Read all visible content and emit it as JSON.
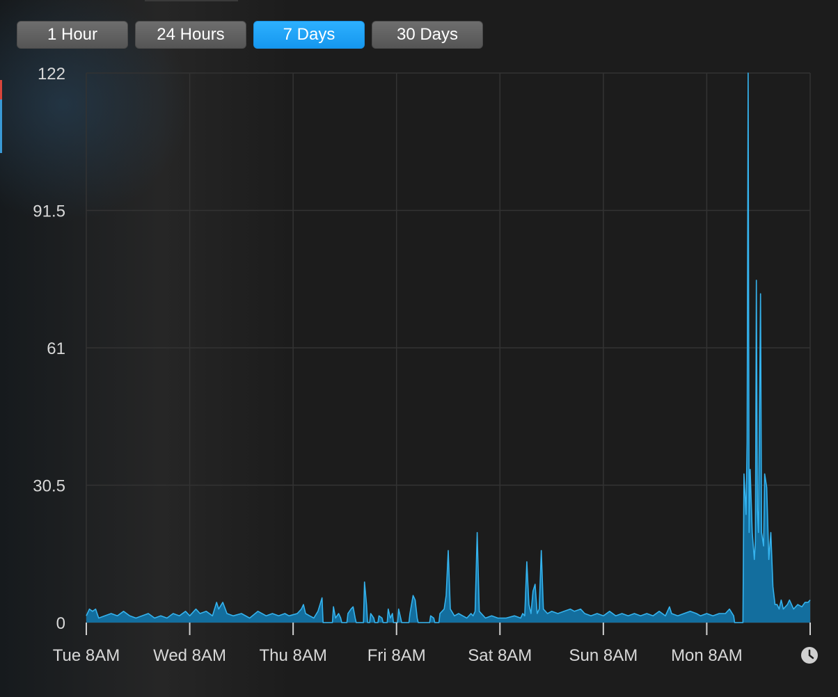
{
  "range_buttons": [
    {
      "label": "1 Hour",
      "active": false
    },
    {
      "label": "24 Hours",
      "active": false
    },
    {
      "label": "7 Days",
      "active": true
    },
    {
      "label": "30 Days",
      "active": false
    }
  ],
  "colors": {
    "line": "#35b3ee",
    "fill": "#136e9e",
    "grid": "#333333",
    "active_button": "#1aa3f7"
  },
  "icons": {
    "time_menu": "clock-icon"
  },
  "chart_data": {
    "type": "area",
    "title": "",
    "xlabel": "",
    "ylabel": "",
    "grid": true,
    "ylim": [
      0,
      122
    ],
    "yticks": [
      "0",
      "30.5",
      "61",
      "91.5",
      "122"
    ],
    "ytick_values": [
      0,
      30.5,
      61,
      91.5,
      122
    ],
    "xlim": [
      0,
      7
    ],
    "xticks": [
      "Tue 8AM",
      "Wed 8AM",
      "Thu 8AM",
      "Fri 8AM",
      "Sat 8AM",
      "Sun 8AM",
      "Mon 8AM"
    ],
    "xtick_values": [
      0,
      1,
      2,
      3,
      4,
      5,
      6
    ],
    "series": [
      {
        "points": [
          [
            0,
            1.5
          ],
          [
            0.03,
            3
          ],
          [
            0.06,
            2.5
          ],
          [
            0.09,
            3
          ],
          [
            0.12,
            1
          ],
          [
            0.18,
            1.5
          ],
          [
            0.24,
            2
          ],
          [
            0.3,
            1.5
          ],
          [
            0.36,
            2.5
          ],
          [
            0.42,
            1.5
          ],
          [
            0.48,
            1
          ],
          [
            0.54,
            1.5
          ],
          [
            0.6,
            2
          ],
          [
            0.66,
            1
          ],
          [
            0.72,
            1.5
          ],
          [
            0.78,
            1
          ],
          [
            0.84,
            2
          ],
          [
            0.9,
            1.5
          ],
          [
            0.96,
            2.5
          ],
          [
            1.0,
            1.5
          ],
          [
            1.06,
            3
          ],
          [
            1.1,
            2
          ],
          [
            1.16,
            2.5
          ],
          [
            1.22,
            1.5
          ],
          [
            1.26,
            4.5
          ],
          [
            1.28,
            3
          ],
          [
            1.32,
            4.5
          ],
          [
            1.36,
            2
          ],
          [
            1.42,
            1.5
          ],
          [
            1.5,
            2
          ],
          [
            1.58,
            1
          ],
          [
            1.66,
            2.5
          ],
          [
            1.74,
            1.5
          ],
          [
            1.8,
            2
          ],
          [
            1.86,
            1.5
          ],
          [
            1.92,
            2
          ],
          [
            1.96,
            1.5
          ],
          [
            2.04,
            2
          ],
          [
            2.08,
            3
          ],
          [
            2.1,
            4
          ],
          [
            2.12,
            2
          ],
          [
            2.16,
            1.5
          ],
          [
            2.2,
            1
          ],
          [
            2.24,
            2.5
          ],
          [
            2.26,
            4
          ],
          [
            2.28,
            5.5
          ],
          [
            2.29,
            0
          ],
          [
            2.38,
            0
          ],
          [
            2.39,
            3.5
          ],
          [
            2.41,
            1
          ],
          [
            2.44,
            2
          ],
          [
            2.46,
            1
          ],
          [
            2.47,
            0
          ],
          [
            2.52,
            0
          ],
          [
            2.53,
            2
          ],
          [
            2.56,
            3
          ],
          [
            2.58,
            3.5
          ],
          [
            2.6,
            1
          ],
          [
            2.61,
            0
          ],
          [
            2.68,
            0
          ],
          [
            2.69,
            9
          ],
          [
            2.71,
            4
          ],
          [
            2.72,
            0
          ],
          [
            2.74,
            0
          ],
          [
            2.75,
            2
          ],
          [
            2.78,
            1
          ],
          [
            2.79,
            0
          ],
          [
            2.82,
            0
          ],
          [
            2.83,
            1.5
          ],
          [
            2.86,
            1
          ],
          [
            2.87,
            0
          ],
          [
            2.91,
            0
          ],
          [
            2.92,
            3
          ],
          [
            2.94,
            1
          ],
          [
            2.96,
            2
          ],
          [
            2.97,
            0
          ],
          [
            3.01,
            0
          ],
          [
            3.02,
            3
          ],
          [
            3.04,
            1
          ],
          [
            3.05,
            0
          ],
          [
            3.12,
            0
          ],
          [
            3.13,
            2
          ],
          [
            3.16,
            6
          ],
          [
            3.18,
            5
          ],
          [
            3.2,
            1
          ],
          [
            3.21,
            0
          ],
          [
            3.32,
            0
          ],
          [
            3.33,
            1.5
          ],
          [
            3.36,
            1
          ],
          [
            3.37,
            0
          ],
          [
            3.41,
            0
          ],
          [
            3.42,
            2
          ],
          [
            3.46,
            3
          ],
          [
            3.48,
            6
          ],
          [
            3.5,
            16
          ],
          [
            3.52,
            3
          ],
          [
            3.56,
            1.5
          ],
          [
            3.6,
            2
          ],
          [
            3.64,
            1.5
          ],
          [
            3.68,
            1
          ],
          [
            3.72,
            2
          ],
          [
            3.74,
            1.5
          ],
          [
            3.76,
            2.5
          ],
          [
            3.78,
            20
          ],
          [
            3.8,
            2.5
          ],
          [
            3.86,
            1
          ],
          [
            3.92,
            1.5
          ],
          [
            3.98,
            1
          ],
          [
            4.06,
            1
          ],
          [
            4.14,
            1.5
          ],
          [
            4.2,
            1
          ],
          [
            4.22,
            2
          ],
          [
            4.24,
            1.5
          ],
          [
            4.26,
            13.5
          ],
          [
            4.28,
            4
          ],
          [
            4.3,
            2
          ],
          [
            4.32,
            7
          ],
          [
            4.34,
            8.5
          ],
          [
            4.36,
            2
          ],
          [
            4.38,
            3
          ],
          [
            4.4,
            16
          ],
          [
            4.42,
            3
          ],
          [
            4.46,
            2
          ],
          [
            4.5,
            2.5
          ],
          [
            4.56,
            2
          ],
          [
            4.62,
            2.5
          ],
          [
            4.68,
            3
          ],
          [
            4.72,
            2.5
          ],
          [
            4.78,
            3
          ],
          [
            4.82,
            2
          ],
          [
            4.88,
            1.5
          ],
          [
            4.94,
            2
          ],
          [
            5.0,
            1.5
          ],
          [
            5.06,
            2.5
          ],
          [
            5.12,
            1.5
          ],
          [
            5.18,
            2
          ],
          [
            5.24,
            1.5
          ],
          [
            5.3,
            2
          ],
          [
            5.36,
            1.5
          ],
          [
            5.42,
            2
          ],
          [
            5.48,
            1.5
          ],
          [
            5.54,
            2.5
          ],
          [
            5.6,
            1.5
          ],
          [
            5.64,
            3.5
          ],
          [
            5.66,
            2
          ],
          [
            5.72,
            1.5
          ],
          [
            5.78,
            2
          ],
          [
            5.84,
            2.5
          ],
          [
            5.9,
            2
          ],
          [
            5.94,
            1.5
          ],
          [
            6.0,
            2
          ],
          [
            6.06,
            1.5
          ],
          [
            6.12,
            2
          ],
          [
            6.18,
            2
          ],
          [
            6.22,
            3
          ],
          [
            6.26,
            1.5
          ],
          [
            6.27,
            0
          ],
          [
            6.35,
            0
          ],
          [
            6.36,
            33
          ],
          [
            6.38,
            24
          ],
          [
            6.39,
            40
          ],
          [
            6.4,
            122
          ],
          [
            6.41,
            20
          ],
          [
            6.42,
            34
          ],
          [
            6.44,
            20
          ],
          [
            6.46,
            14
          ],
          [
            6.47,
            18
          ],
          [
            6.48,
            76
          ],
          [
            6.49,
            25
          ],
          [
            6.5,
            20
          ],
          [
            6.52,
            73
          ],
          [
            6.53,
            20
          ],
          [
            6.55,
            17
          ],
          [
            6.56,
            33
          ],
          [
            6.58,
            30
          ],
          [
            6.6,
            14
          ],
          [
            6.62,
            20
          ],
          [
            6.64,
            8
          ],
          [
            6.66,
            4
          ],
          [
            6.68,
            4
          ],
          [
            6.7,
            3
          ],
          [
            6.72,
            5
          ],
          [
            6.74,
            3
          ],
          [
            6.78,
            4
          ],
          [
            6.8,
            5
          ],
          [
            6.84,
            3
          ],
          [
            6.88,
            4
          ],
          [
            6.92,
            3.5
          ],
          [
            6.95,
            4.5
          ],
          [
            6.98,
            4.5
          ],
          [
            7.0,
            5
          ]
        ]
      }
    ]
  }
}
